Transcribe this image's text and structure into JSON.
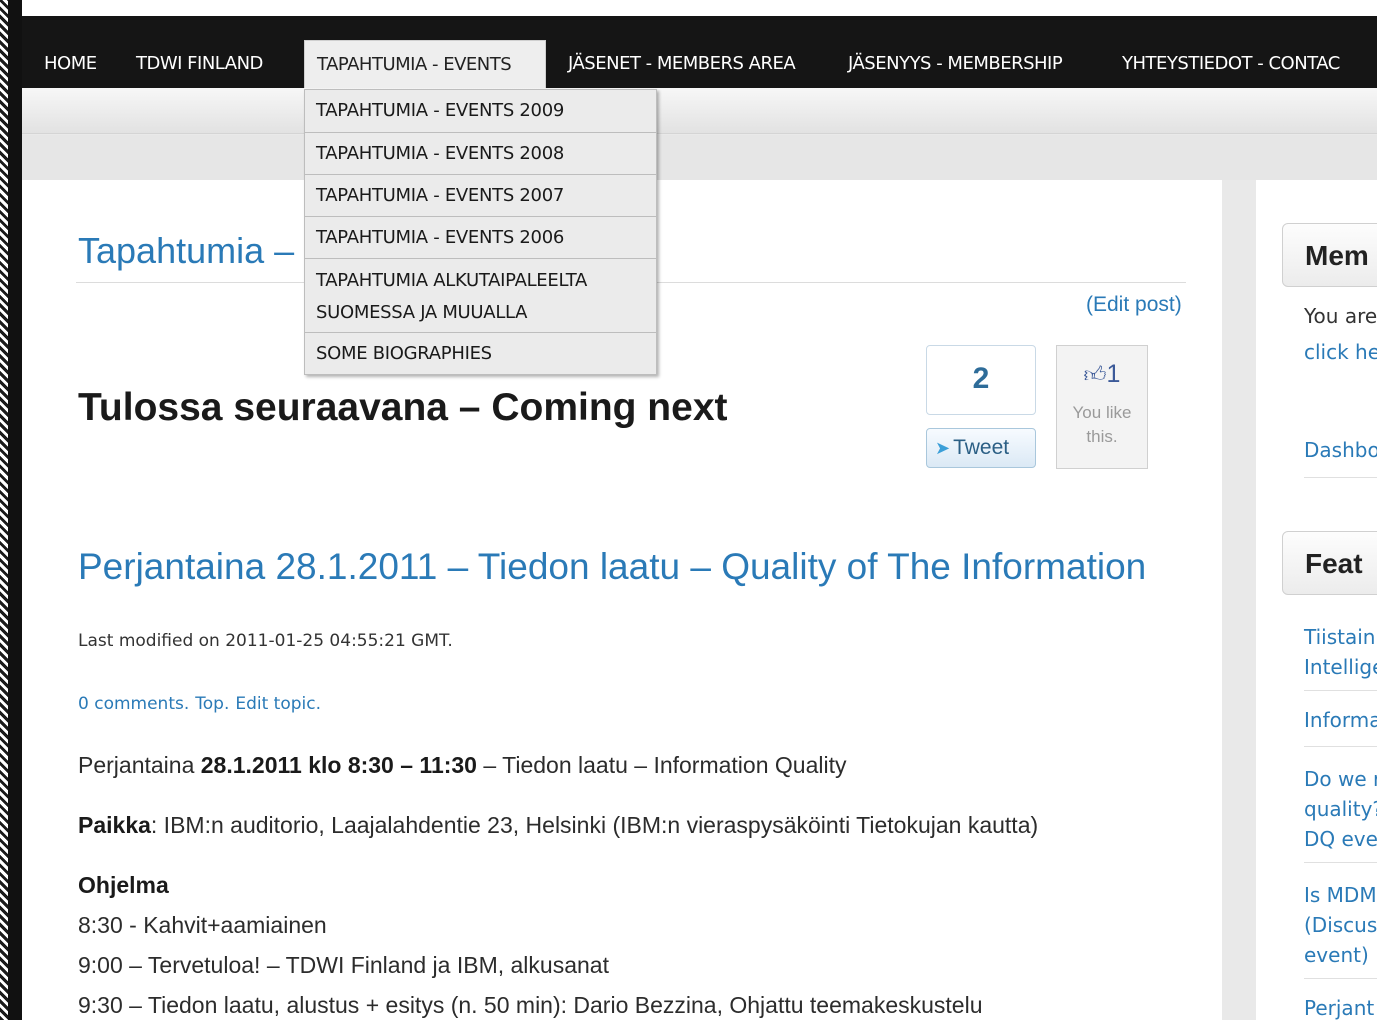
{
  "nav": {
    "items": [
      {
        "label": "HOME"
      },
      {
        "label": "TDWI FINLAND"
      },
      {
        "label": "TAPAHTUMIA - EVENTS"
      },
      {
        "label": "JÄSENET - MEMBERS AREA"
      },
      {
        "label": "JÄSENYYS - MEMBERSHIP"
      },
      {
        "label": "YHTEYSTIEDOT - CONTAC"
      }
    ],
    "dropdown": [
      {
        "label": "TAPAHTUMIA - EVENTS 2009"
      },
      {
        "label": "TAPAHTUMIA - EVENTS 2008"
      },
      {
        "label": "TAPAHTUMIA - EVENTS 2007"
      },
      {
        "label": "TAPAHTUMIA - EVENTS 2006"
      },
      {
        "label_line1": "TAPAHTUMIA ALKUTAIPALEELTA",
        "label_line2": "SUOMESSA JA MUUALLA"
      },
      {
        "label": "SOME BIOGRAPHIES"
      }
    ]
  },
  "page": {
    "title": "Tapahtumia –",
    "edit_post": "(Edit post)",
    "heading": "Tulossa seuraavana – Coming next"
  },
  "social": {
    "tweet_count": "2",
    "tweet_label": "Tweet",
    "like_count": "1",
    "like_text_line1": "You like",
    "like_text_line2": "this."
  },
  "article": {
    "title": "Perjantaina 28.1.2011 – Tiedon laatu – Quality of The Information",
    "modified": "Last modified on 2011-01-25 04:55:21 GMT.",
    "links": {
      "comments": "0 comments.",
      "top": "Top.",
      "edit_topic": "Edit topic."
    },
    "date_line": {
      "prefix": "Perjantaina ",
      "bold": "28.1.2011 klo 8:30 – 11:30",
      "suffix": " – Tiedon laatu – Information Quality"
    },
    "place": {
      "label": "Paikka",
      "text": ": IBM:n auditorio, Laajalahdentie 23, Helsinki (IBM:n vieraspysäköinti Tietokujan kautta)"
    },
    "program_heading": "Ohjelma",
    "program": [
      "8:30 - Kahvit+aamiainen",
      "9:00 – Tervetuloa! – TDWI Finland ja IBM, alkusanat",
      "9:30 – Tiedon laatu, alustus + esitys (n. 50 min): Dario Bezzina, Ohjattu teemakeskustelu"
    ]
  },
  "sidebar": {
    "members_title": "Mem",
    "members_text1": "You are",
    "members_link": "click he",
    "dashboard": "Dashbo",
    "featured_title": "Feat",
    "featured": [
      {
        "line1": "Tiistain",
        "line2": "Intellige"
      },
      {
        "line1": "Informa"
      },
      {
        "line1": "Do we r",
        "line2": "quality?",
        "line3": "DQ eve"
      },
      {
        "line1": "Is MDM",
        "line2": "(Discus",
        "line3": "event)"
      },
      {
        "line1": "Perjant"
      }
    ]
  },
  "colors": {
    "link": "#2a7ab7",
    "nav_bg": "#151515",
    "text": "#2c2c2c"
  }
}
